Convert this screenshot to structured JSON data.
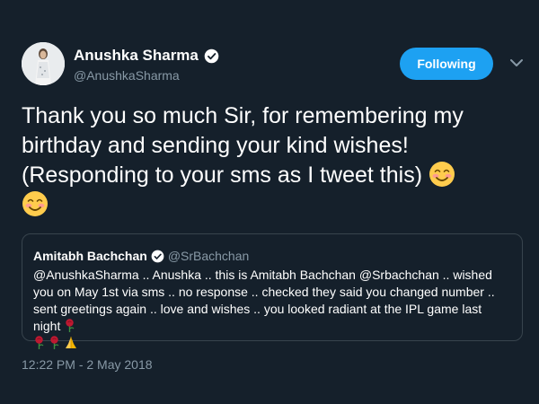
{
  "author": {
    "name": "Anushka Sharma",
    "handle": "@AnushkaSharma",
    "avatar": "profile-photo"
  },
  "follow_button": {
    "label": "Following"
  },
  "menu": {
    "icon": "chevron-down-icon"
  },
  "tweet": {
    "text": "Thank you so much Sir, for remembering my birthday and sending your kind wishes! (Responding to your sms as I tweet this)",
    "emoji": "smiling-face-with-smiling-eyes"
  },
  "quoted": {
    "name": "Amitabh Bachchan",
    "handle": "@SrBachchan",
    "text": "@AnushkaSharma .. Anushka .. this is Amitabh Bachchan @Srbachchan .. wished you on May 1st via sms .. no response .. checked they said you changed number .. sent greetings again .. love and wishes .. you looked radiant at the IPL game last night"
  },
  "timestamp": "12:22 PM - 2 May 2018",
  "colors": {
    "background": "#15202b",
    "accent": "#1da1f2",
    "muted_text": "#8899a6",
    "border": "#38444d"
  }
}
